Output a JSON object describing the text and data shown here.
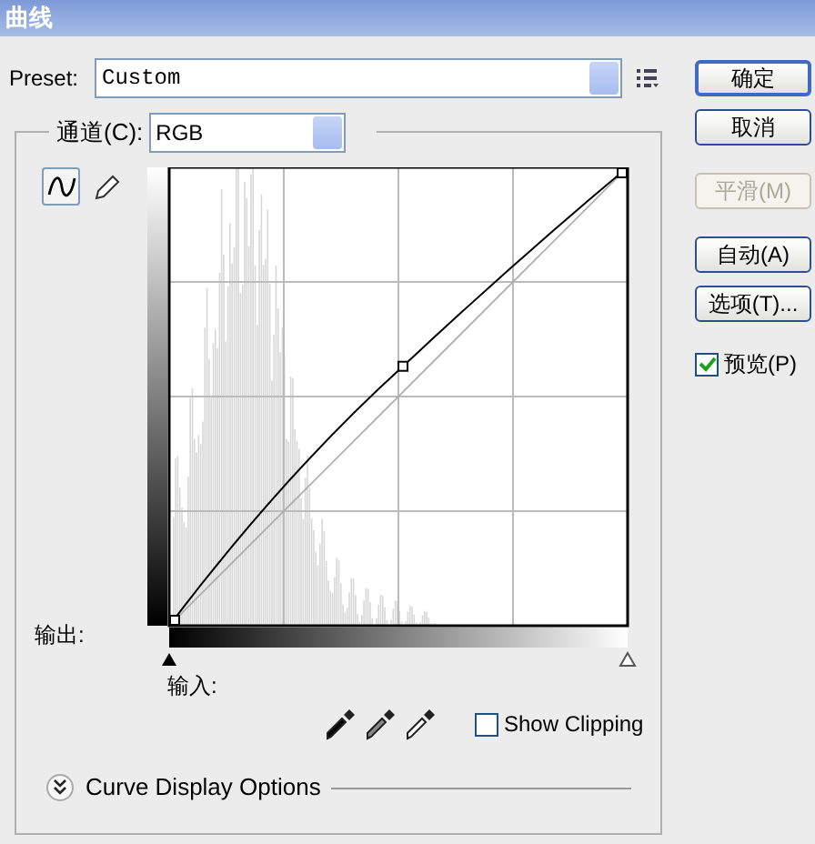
{
  "window": {
    "title": "曲线"
  },
  "preset": {
    "label": "Preset:",
    "value": "Custom"
  },
  "channel": {
    "label": "通道(C):",
    "value": "RGB"
  },
  "tools": [
    {
      "kind": "curve",
      "selected": true
    },
    {
      "kind": "pencil",
      "selected": false
    }
  ],
  "graph": {
    "output_label": "输出:",
    "input_label": "输入:"
  },
  "show_clipping": {
    "label": "Show Clipping",
    "checked": false
  },
  "display_options": {
    "label": "Curve Display Options",
    "expanded": false
  },
  "buttons": [
    {
      "label": "确定",
      "default": true,
      "disabled": false
    },
    {
      "label": "取消",
      "default": false,
      "disabled": false
    },
    {
      "label": "平滑(M)",
      "default": false,
      "disabled": true
    },
    {
      "label": "自动(A)",
      "default": false,
      "disabled": false
    },
    {
      "label": "选项(T)...",
      "default": false,
      "disabled": false
    }
  ],
  "preview": {
    "label": "预览(P)",
    "checked": true
  }
}
